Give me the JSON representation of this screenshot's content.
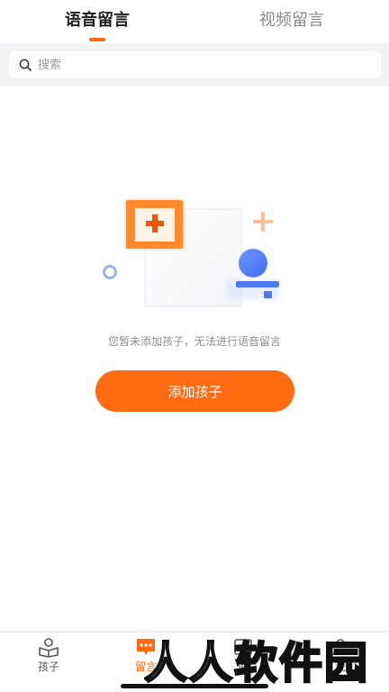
{
  "tabs": [
    {
      "label": "语音留言",
      "active": true
    },
    {
      "label": "视频留言",
      "active": false
    }
  ],
  "search": {
    "placeholder": "搜索",
    "value": "",
    "icon": "search-icon"
  },
  "empty_state": {
    "message": "您暂未添加孩子，无法进行语音留言",
    "button_label": "添加孩子"
  },
  "bottom_nav": [
    {
      "label": "孩子",
      "icon": "child-book-icon",
      "active": false
    },
    {
      "label": "留言",
      "icon": "message-icon",
      "active": true
    },
    {
      "label": "通",
      "icon": "contact-icon",
      "active": false
    },
    {
      "label": "我",
      "icon": "profile-icon",
      "active": false
    }
  ],
  "watermark": {
    "text": "人人软件园"
  },
  "colors": {
    "accent": "#ff6a13",
    "search_bg": "#f2f2f4",
    "text_primary": "#1f1f1f",
    "text_secondary": "#8b8b8b"
  }
}
